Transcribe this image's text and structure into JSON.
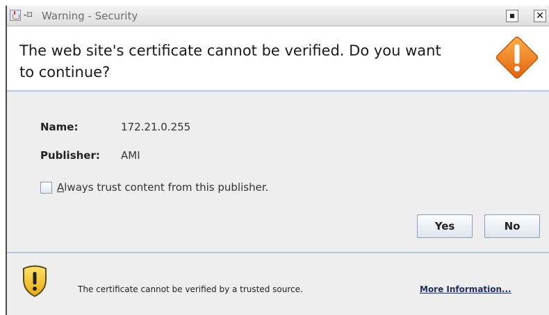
{
  "window": {
    "title": "Warning - Security",
    "pin_glyph": "-⌑"
  },
  "header": {
    "message": "The web site's certificate cannot be verified.  Do you want to continue?"
  },
  "details": {
    "name_label": "Name:",
    "name_value": "172.21.0.255",
    "publisher_label": "Publisher:",
    "publisher_value": "AMI"
  },
  "trust": {
    "checked": false,
    "label_mnemonic": "A",
    "label_rest": "lways trust content from this publisher."
  },
  "buttons": {
    "yes": "Yes",
    "no": "No"
  },
  "footer": {
    "message": "The certificate cannot be verified by a trusted source.",
    "more_info": "More Information..."
  },
  "icons": {
    "app": "java-cup-icon",
    "warning": "warning-diamond-icon",
    "shield": "shield-warning-icon"
  },
  "colors": {
    "warning_orange": "#f07d1a",
    "shield_yellow": "#f3c21b",
    "accent_line": "#b7c6e0"
  }
}
